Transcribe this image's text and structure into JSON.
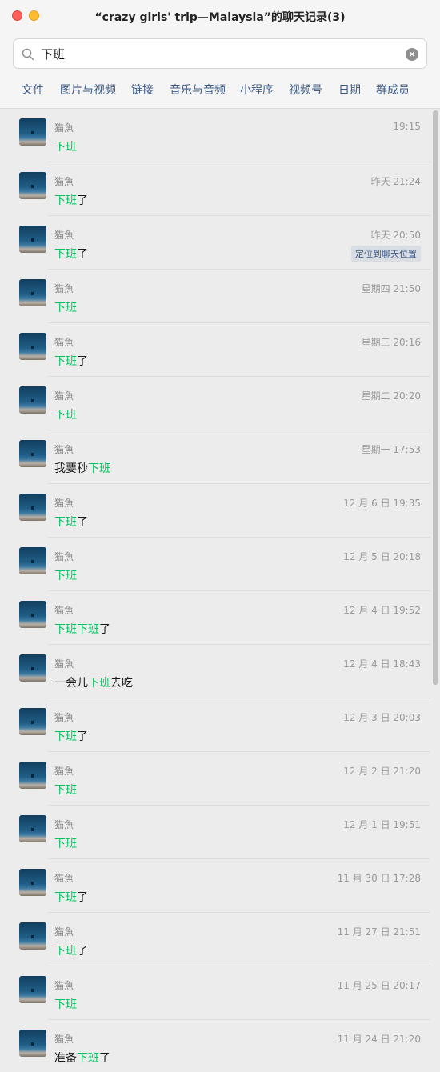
{
  "window": {
    "title": "“crazy girls' trip—Malaysia”的聊天记录(3)"
  },
  "search": {
    "value": "下班",
    "placeholder": ""
  },
  "tabs": [
    "文件",
    "图片与视频",
    "链接",
    "音乐与音频",
    "小程序",
    "视频号",
    "日期",
    "群成员"
  ],
  "colors": {
    "highlight": "#07c160",
    "tab": "#3d5a88",
    "background": "#ececec"
  },
  "icons": {
    "search": "search-icon",
    "clear": "clear-icon",
    "close": "close-window-icon",
    "minimize": "minimize-window-icon"
  },
  "messages": [
    {
      "sender": "猫魚",
      "time": "19:15",
      "parts": [
        {
          "t": "下班",
          "hl": true
        }
      ]
    },
    {
      "sender": "猫魚",
      "time": "昨天 21:24",
      "parts": [
        {
          "t": "下班",
          "hl": true
        },
        {
          "t": "了",
          "hl": false
        }
      ]
    },
    {
      "sender": "猫魚",
      "time": "昨天 20:50",
      "parts": [
        {
          "t": "下班",
          "hl": true
        },
        {
          "t": "了",
          "hl": false
        }
      ],
      "action": "定位到聊天位置"
    },
    {
      "sender": "猫魚",
      "time": "星期四 21:50",
      "parts": [
        {
          "t": "下班",
          "hl": true
        }
      ]
    },
    {
      "sender": "猫魚",
      "time": "星期三 20:16",
      "parts": [
        {
          "t": "下班",
          "hl": true
        },
        {
          "t": "了",
          "hl": false
        }
      ]
    },
    {
      "sender": "猫魚",
      "time": "星期二 20:20",
      "parts": [
        {
          "t": "下班",
          "hl": true
        }
      ]
    },
    {
      "sender": "猫魚",
      "time": "星期一 17:53",
      "parts": [
        {
          "t": "我要秒",
          "hl": false
        },
        {
          "t": "下班",
          "hl": true
        }
      ]
    },
    {
      "sender": "猫魚",
      "time": "12 月 6 日 19:35",
      "parts": [
        {
          "t": "下班",
          "hl": true
        },
        {
          "t": "了",
          "hl": false
        }
      ]
    },
    {
      "sender": "猫魚",
      "time": "12 月 5 日 20:18",
      "parts": [
        {
          "t": "下班",
          "hl": true
        }
      ]
    },
    {
      "sender": "猫魚",
      "time": "12 月 4 日 19:52",
      "parts": [
        {
          "t": "下班",
          "hl": true
        },
        {
          "t": "下班",
          "hl": true
        },
        {
          "t": "了",
          "hl": false
        }
      ]
    },
    {
      "sender": "猫魚",
      "time": "12 月 4 日 18:43",
      "parts": [
        {
          "t": "一会儿",
          "hl": false
        },
        {
          "t": "下班",
          "hl": true
        },
        {
          "t": "去吃",
          "hl": false
        }
      ]
    },
    {
      "sender": "猫魚",
      "time": "12 月 3 日 20:03",
      "parts": [
        {
          "t": "下班",
          "hl": true
        },
        {
          "t": "了",
          "hl": false
        }
      ]
    },
    {
      "sender": "猫魚",
      "time": "12 月 2 日 21:20",
      "parts": [
        {
          "t": "下班",
          "hl": true
        }
      ]
    },
    {
      "sender": "猫魚",
      "time": "12 月 1 日 19:51",
      "parts": [
        {
          "t": "下班",
          "hl": true
        }
      ]
    },
    {
      "sender": "猫魚",
      "time": "11 月 30 日 17:28",
      "parts": [
        {
          "t": "下班",
          "hl": true
        },
        {
          "t": "了",
          "hl": false
        }
      ]
    },
    {
      "sender": "猫魚",
      "time": "11 月 27 日 21:51",
      "parts": [
        {
          "t": "下班",
          "hl": true
        },
        {
          "t": "了",
          "hl": false
        }
      ]
    },
    {
      "sender": "猫魚",
      "time": "11 月 25 日 20:17",
      "parts": [
        {
          "t": " 下班",
          "hl": true
        }
      ]
    },
    {
      "sender": "猫魚",
      "time": "11 月 24 日 21:20",
      "parts": [
        {
          "t": "准备",
          "hl": false
        },
        {
          "t": "下班",
          "hl": true
        },
        {
          "t": "了",
          "hl": false
        }
      ]
    }
  ]
}
